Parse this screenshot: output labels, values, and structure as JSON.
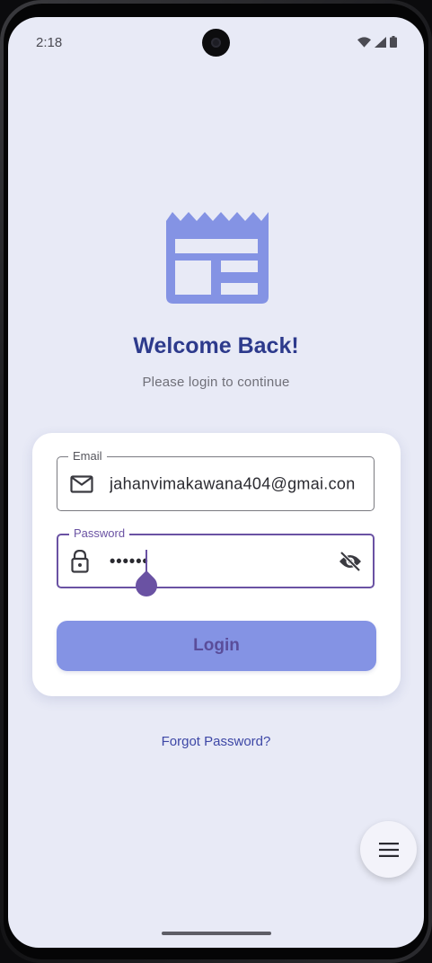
{
  "status_bar": {
    "time": "2:18",
    "icons": [
      "wifi-icon",
      "signal-icon",
      "battery-icon"
    ]
  },
  "header": {
    "logo_icon": "newspaper-icon",
    "title": "Welcome Back!",
    "subtitle": "Please login to continue"
  },
  "form": {
    "email": {
      "label": "Email",
      "icon": "mail-icon",
      "value": "jahanvimakawana404@gmai.con"
    },
    "password": {
      "label": "Password",
      "icon": "lock-icon",
      "value": "••••••",
      "visibility_icon": "eye-off-icon"
    },
    "login_label": "Login"
  },
  "forgot_password": "Forgot Password?",
  "fab": {
    "icon": "menu-icon"
  },
  "colors": {
    "background": "#e8eaf6",
    "title": "#2d3a8c",
    "accent": "#6a52a3",
    "button": "#8493e4",
    "logo": "#8493e4",
    "link": "#3d47a6"
  }
}
